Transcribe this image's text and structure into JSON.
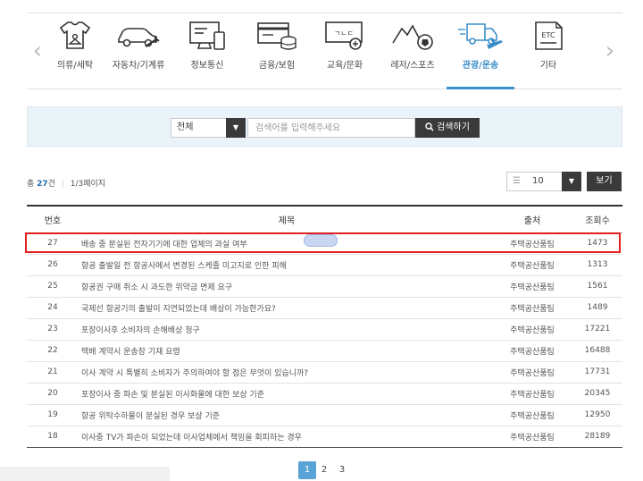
{
  "categories": [
    {
      "label": "의류/세탁",
      "icon": "clothing-icon",
      "active": false
    },
    {
      "label": "자동차/기계류",
      "icon": "car-icon",
      "active": false
    },
    {
      "label": "정보통신",
      "icon": "computer-icon",
      "active": false
    },
    {
      "label": "금융/보험",
      "icon": "finance-icon",
      "active": false
    },
    {
      "label": "교육/문화",
      "icon": "education-icon",
      "active": false
    },
    {
      "label": "레저/스포츠",
      "icon": "sports-icon",
      "active": false
    },
    {
      "label": "관광/운송",
      "icon": "transport-icon",
      "active": true
    },
    {
      "label": "기타",
      "icon": "etc-icon",
      "active": false
    }
  ],
  "etc_icon_text": "ETC",
  "edu_icon_text": "ㄱㄴㄷ",
  "search": {
    "select_value": "전체",
    "placeholder": "검색어를 입력해주세요",
    "button_label": "검색하기"
  },
  "summary": {
    "total_prefix": "총",
    "total_count": "27",
    "total_suffix": "건",
    "page_info": "1/3페이지"
  },
  "page_size": {
    "value": "10"
  },
  "view_button": "보기",
  "table": {
    "headers": {
      "no": "번호",
      "title": "제목",
      "source": "출처",
      "views": "조회수"
    },
    "rows": [
      {
        "no": "27",
        "title": "배송 중 분실된 전자기기에 대한 업체의 과실 여부",
        "source": "주택공산품팀",
        "views": "1473"
      },
      {
        "no": "26",
        "title": "항공 출발일 전 항공사에서 변경된 스케줄 미고지로 인한 피해",
        "source": "주택공산품팀",
        "views": "1313"
      },
      {
        "no": "25",
        "title": "항공권 구매 취소 시 과도한 위약금 면제 요구",
        "source": "주택공산품팀",
        "views": "1561"
      },
      {
        "no": "24",
        "title": "국제선 항공기의 출발이 지연되었는데 배상이 가능한가요?",
        "source": "주택공산품팀",
        "views": "1489"
      },
      {
        "no": "23",
        "title": "포장이사후 소비자의 손해배상 청구",
        "source": "주택공산품팀",
        "views": "17221"
      },
      {
        "no": "22",
        "title": "택배 계약시 운송장 기재 요령",
        "source": "주택공산품팀",
        "views": "16488"
      },
      {
        "no": "21",
        "title": "이사 계약 시 특별히 소비자가 주의하여야 할 점은 무엇이 있습니까?",
        "source": "주택공산품팀",
        "views": "17731"
      },
      {
        "no": "20",
        "title": "포장이사 중 파손 및 분실된 이사화물에 대한 보상 기준",
        "source": "주택공산품팀",
        "views": "20345"
      },
      {
        "no": "19",
        "title": "항공 위탁수하물이 분실된 경우 보상 기준",
        "source": "주택공산품팀",
        "views": "12950"
      },
      {
        "no": "18",
        "title": "이사중 TV가 파손이 되었는데 이사업체에서 책임을 회피하는 경우",
        "source": "주택공산품팀",
        "views": "28189"
      }
    ]
  },
  "pagination": {
    "pages": [
      "1",
      "2",
      "3"
    ],
    "current": "1"
  },
  "colors": {
    "accent": "#3b8ec9",
    "dark_button": "#3a3a3a",
    "highlight": "#e02020",
    "search_bg": "#eaf3f8"
  }
}
